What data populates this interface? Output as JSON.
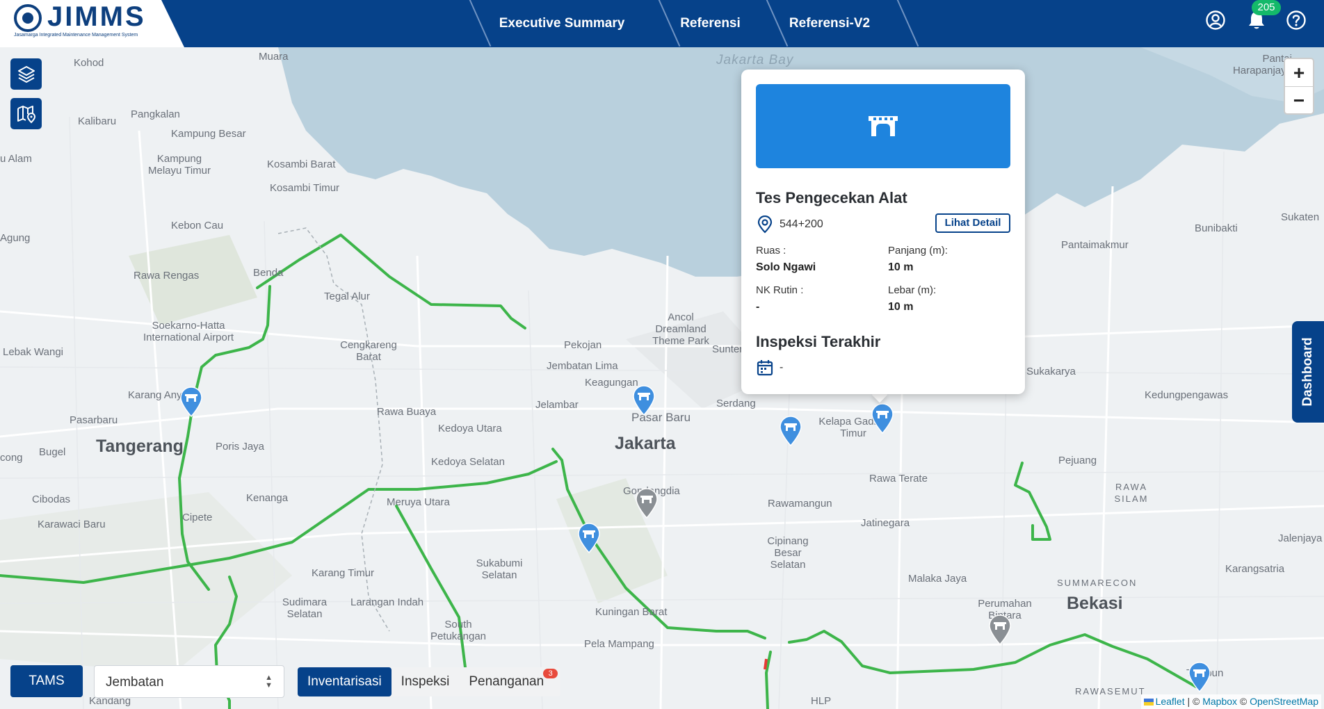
{
  "header": {
    "logo_text": "JIMMS",
    "logo_subtitle": "Jasamarga Integrated Maintenance Management System",
    "nav": [
      "Executive Summary",
      "Referensi",
      "Referensi-V2"
    ],
    "notification_count": "205",
    "colors": {
      "primary": "#06428a",
      "badge": "#14b96a"
    }
  },
  "map": {
    "places": [
      "Jakarta Bay",
      "Kohod",
      "Muara",
      "Kalibaru",
      "Pangkalan",
      "Kampung Besar",
      "Kampung Melayu Timur",
      "Kosambi Barat",
      "Kosambi Timur",
      "Kebon Cau",
      "Agung",
      "Rawa Rengas",
      "Benda",
      "Tegal Alur",
      "Soekarno-Hatta International Airport",
      "Lebak Wangi",
      "Cengkareng Barat",
      "Pekojan",
      "Jembatan Lima",
      "Keagungan",
      "Ancol Dreamland Theme Park",
      "Sunter",
      "Karang Anyar",
      "Pasarbaru",
      "Rawa Buaya",
      "Kedoya Utara",
      "Jelambar",
      "Pasar Baru",
      "Serdang",
      "Kelapa Gading Timur",
      "Tangerang",
      "Poris Jaya",
      "Bugel",
      "Kedoya Selatan",
      "Jakarta",
      "Rawa Terate",
      "Pejuang",
      "Cibodas",
      "Kenanga",
      "Meruya Utara",
      "Gondangdia",
      "Rawamangun",
      "Jatinegara",
      "Karawaci Baru",
      "Cipete",
      "Karang Timur",
      "Sukabumi Selatan",
      "Malaka Jaya",
      "Sudimara Selatan",
      "Larangan Indah",
      "Kuningan Barat",
      "Cipinang Besar Selatan",
      "Perumahan Bintara",
      "Bekasi",
      "South Petukangan",
      "Pela Mampang",
      "Tambun",
      "Kandang",
      "HLP",
      "Pantai Harapanjaya",
      "Bunibakti",
      "Sukaten",
      "Pantaimakmur",
      "Sukakarya",
      "Kedungpengawas",
      "RAWA SILAM",
      "Jalenjaya",
      "Karangsatria",
      "SUMMARECON",
      "RAWASEMUT",
      "u Alam",
      "cong"
    ],
    "controls": {
      "layers": "layers-icon",
      "map": "map-pin-icon",
      "zoom_in": "+",
      "zoom_out": "−"
    },
    "route_color": "#3db54a"
  },
  "popup": {
    "title": "Tes Pengecekan Alat",
    "location": "544+200",
    "detail_button": "Lihat Detail",
    "ruas_label": "Ruas :",
    "ruas_value": "Solo Ngawi",
    "panjang_label": "Panjang (m):",
    "panjang_value": "10 m",
    "nk_label": "NK Rutin :",
    "nk_value": "-",
    "lebar_label": "Lebar (m):",
    "lebar_value": "10 m",
    "inspeksi_title": "Inspeksi Terakhir",
    "inspeksi_value": "-"
  },
  "dashboard_tab": "Dashboard",
  "toolbar": {
    "tams": "TAMS",
    "select_value": "Jembatan",
    "tabs": [
      "Inventarisasi",
      "Inspeksi",
      "Penanganan"
    ],
    "active_tab": "Inventarisasi",
    "penanganan_badge": "3"
  },
  "attribution": {
    "leaflet": "Leaflet",
    "sep1": " | © ",
    "mapbox": "Mapbox",
    "sep2": " © ",
    "osm": "OpenStreetMap"
  }
}
